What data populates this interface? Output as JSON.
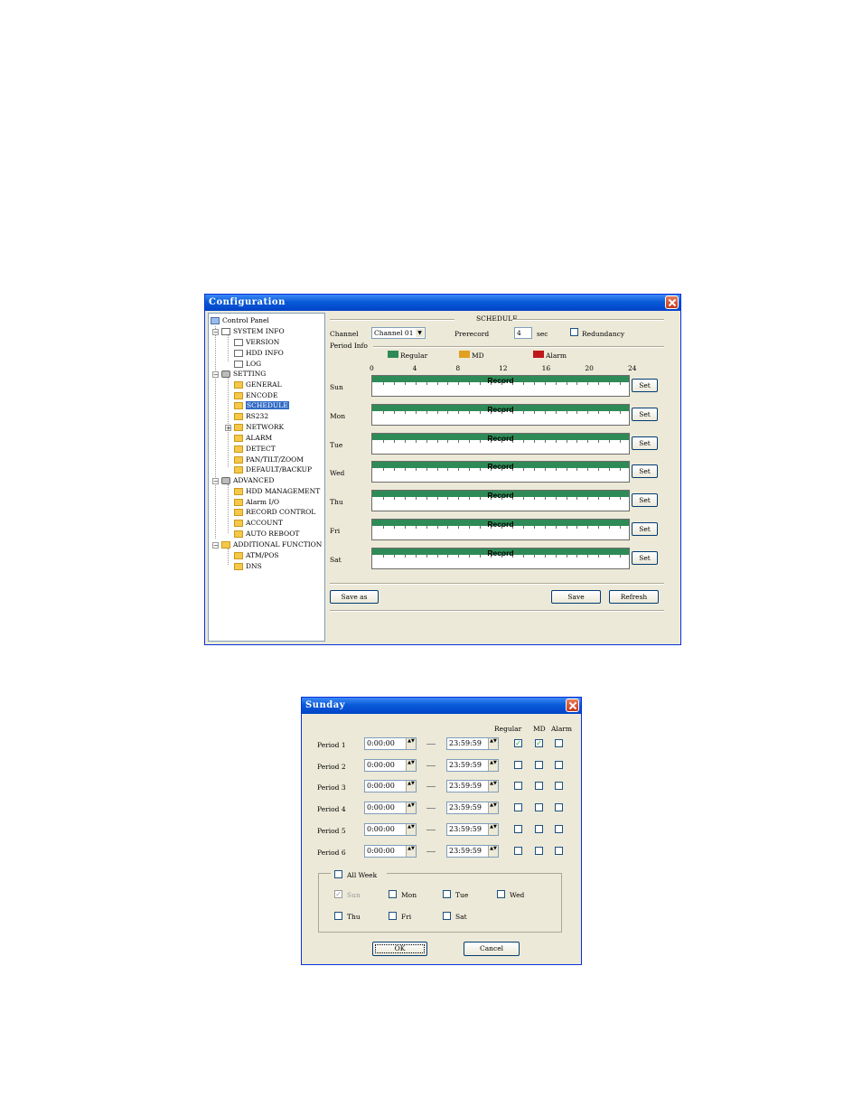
{
  "config_window": {
    "title": "Configuration",
    "tree": {
      "root": "Control Panel",
      "system_info": "SYSTEM INFO",
      "version": "VERSION",
      "hdd_info": "HDD INFO",
      "log": "LOG",
      "setting": "SETTING",
      "general": "GENERAL",
      "encode": "ENCODE",
      "schedule": "SCHEDULE",
      "rs232": "RS232",
      "network": "NETWORK",
      "alarm": "ALARM",
      "detect": "DETECT",
      "ptz": "PAN/TILT/ZOOM",
      "default_backup": "DEFAULT/BACKUP",
      "advanced": "ADVANCED",
      "hdd_management": "HDD MANAGEMENT",
      "alarm_io": "Alarm I/O",
      "record_control": "RECORD CONTROL",
      "account": "ACCOUNT",
      "auto_reboot": "AUTO REBOOT",
      "additional": "ADDITIONAL FUNCTION",
      "atm_pos": "ATM/POS",
      "dns": "DNS"
    },
    "panel": {
      "heading": "SCHEDULE",
      "channel_label": "Channel",
      "channel_value": "Channel 01",
      "prerecord_label": "Prerecord",
      "prerecord_value": "4",
      "prerecord_unit": "sec",
      "redundancy_label": "Redundancy",
      "period_info": "Period Info",
      "legend": [
        {
          "label": "Regular",
          "color": "#2e8b57"
        },
        {
          "label": "MD",
          "color": "#e0a020"
        },
        {
          "label": "Alarm",
          "color": "#c0181c"
        }
      ],
      "hours": [
        "0",
        "4",
        "8",
        "12",
        "16",
        "20",
        "24"
      ],
      "days": [
        {
          "day": "Sun",
          "bar": "Record",
          "btn": "Set"
        },
        {
          "day": "Mon",
          "bar": "Record",
          "btn": "Set"
        },
        {
          "day": "Tue",
          "bar": "Record",
          "btn": "Set"
        },
        {
          "day": "Wed",
          "bar": "Record",
          "btn": "Set"
        },
        {
          "day": "Thu",
          "bar": "Record",
          "btn": "Set"
        },
        {
          "day": "Fri",
          "bar": "Record",
          "btn": "Set"
        },
        {
          "day": "Sat",
          "bar": "Record",
          "btn": "Set"
        }
      ],
      "save_as": "Save as",
      "save": "Save",
      "refresh": "Refresh"
    }
  },
  "sunday_dialog": {
    "title": "Sunday",
    "col_regular": "Regular",
    "col_md": "MD",
    "col_alarm": "Alarm",
    "periods": [
      {
        "label": "Period 1",
        "start": "0:00:00",
        "end": "23:59:59",
        "regular": true,
        "md": true,
        "alarm": false
      },
      {
        "label": "Period 2",
        "start": "0:00:00",
        "end": "23:59:59",
        "regular": false,
        "md": false,
        "alarm": false
      },
      {
        "label": "Period 3",
        "start": "0:00:00",
        "end": "23:59:59",
        "regular": false,
        "md": false,
        "alarm": false
      },
      {
        "label": "Period 4",
        "start": "0:00:00",
        "end": "23:59:59",
        "regular": false,
        "md": false,
        "alarm": false
      },
      {
        "label": "Period 5",
        "start": "0:00:00",
        "end": "23:59:59",
        "regular": false,
        "md": false,
        "alarm": false
      },
      {
        "label": "Period 6",
        "start": "0:00:00",
        "end": "23:59:59",
        "regular": false,
        "md": false,
        "alarm": false
      }
    ],
    "all_week": "All Week",
    "weekdays": {
      "sun": "Sun",
      "mon": "Mon",
      "tue": "Tue",
      "wed": "Wed",
      "thu": "Thu",
      "fri": "Fri",
      "sat": "Sat"
    },
    "ok": "OK",
    "cancel": "Cancel"
  }
}
